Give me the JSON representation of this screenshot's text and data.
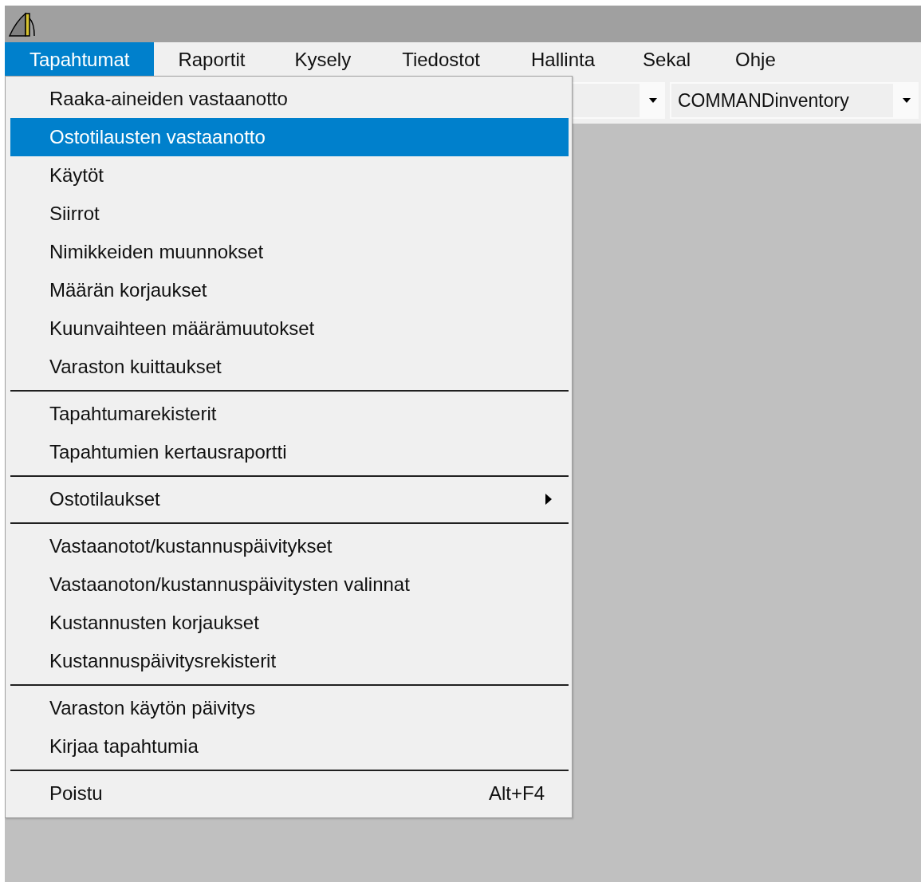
{
  "menubar": [
    {
      "label": "Tapahtumat",
      "selected": true
    },
    {
      "label": "Raportit",
      "selected": false
    },
    {
      "label": "Kysely",
      "selected": false
    },
    {
      "label": "Tiedostot",
      "selected": false
    },
    {
      "label": "Hallinta",
      "selected": false
    },
    {
      "label": "Sekal",
      "selected": false
    },
    {
      "label": "Ohje",
      "selected": false
    }
  ],
  "toolbar": {
    "database_combo": {
      "value": "COMMANDinventory"
    }
  },
  "menu": {
    "groups": [
      [
        {
          "label": "Raaka-aineiden vastaanotto",
          "selected": false
        },
        {
          "label": "Ostotilausten vastaanotto",
          "selected": true
        },
        {
          "label": "Käytöt",
          "selected": false
        },
        {
          "label": "Siirrot",
          "selected": false
        },
        {
          "label": "Nimikkeiden muunnokset",
          "selected": false
        },
        {
          "label": "Määrän korjaukset",
          "selected": false
        },
        {
          "label": "Kuunvaihteen määrämuutokset",
          "selected": false
        },
        {
          "label": "Varaston kuittaukset",
          "selected": false
        }
      ],
      [
        {
          "label": "Tapahtumarekisterit",
          "selected": false
        },
        {
          "label": "Tapahtumien kertausraportti",
          "selected": false
        }
      ],
      [
        {
          "label": "Ostotilaukset",
          "selected": false,
          "submenu": true
        }
      ],
      [
        {
          "label": "Vastaanotot/kustannuspäivitykset",
          "selected": false
        },
        {
          "label": "Vastaanoton/kustannuspäivitysten valinnat",
          "selected": false
        },
        {
          "label": "Kustannusten korjaukset",
          "selected": false
        },
        {
          "label": "Kustannuspäivitysrekisterit",
          "selected": false
        }
      ],
      [
        {
          "label": "Varaston käytön päivitys",
          "selected": false
        },
        {
          "label": "Kirjaa tapahtumia",
          "selected": false
        }
      ],
      [
        {
          "label": "Poistu",
          "selected": false,
          "shortcut": "Alt+F4"
        }
      ]
    ]
  }
}
